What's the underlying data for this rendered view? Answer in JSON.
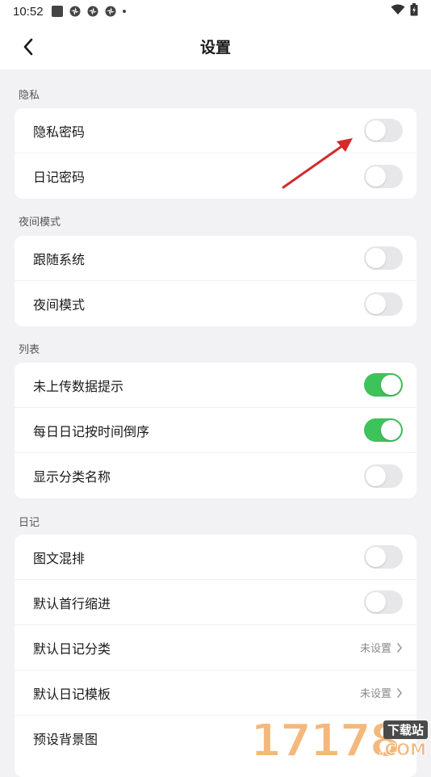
{
  "status_bar": {
    "time": "10:52",
    "icons": [
      "app-square-icon",
      "pinwheel-icon",
      "pinwheel-icon",
      "pinwheel-icon",
      "dot-icon"
    ],
    "right_icons": [
      "wifi-icon",
      "battery-charging-icon"
    ]
  },
  "header": {
    "title": "设置",
    "back_icon": "chevron-left-icon"
  },
  "sections": [
    {
      "label": "隐私",
      "rows": [
        {
          "label": "隐私密码",
          "type": "toggle",
          "on": false
        },
        {
          "label": "日记密码",
          "type": "toggle",
          "on": false
        }
      ]
    },
    {
      "label": "夜间模式",
      "rows": [
        {
          "label": "跟随系统",
          "type": "toggle",
          "on": false
        },
        {
          "label": "夜间模式",
          "type": "toggle",
          "on": false
        }
      ]
    },
    {
      "label": "列表",
      "rows": [
        {
          "label": "未上传数据提示",
          "type": "toggle",
          "on": true
        },
        {
          "label": "每日日记按时间倒序",
          "type": "toggle",
          "on": true
        },
        {
          "label": "显示分类名称",
          "type": "toggle",
          "on": false
        }
      ]
    },
    {
      "label": "日记",
      "rows": [
        {
          "label": "图文混排",
          "type": "toggle",
          "on": false
        },
        {
          "label": "默认首行缩进",
          "type": "toggle",
          "on": false
        },
        {
          "label": "默认日记分类",
          "type": "value",
          "value": "未设置"
        },
        {
          "label": "默认日记模板",
          "type": "value",
          "value": "未设置"
        },
        {
          "label": "预设背景图",
          "type": "value",
          "value": ""
        }
      ]
    }
  ],
  "colors": {
    "toggle_on": "#3ec25a",
    "toggle_off": "#e7e7ea",
    "background": "#f2f2f4",
    "annotation_arrow": "#d42a2a"
  },
  "watermark": {
    "digits": "17178",
    "badge": "下载站",
    "suffix": ".COM"
  }
}
